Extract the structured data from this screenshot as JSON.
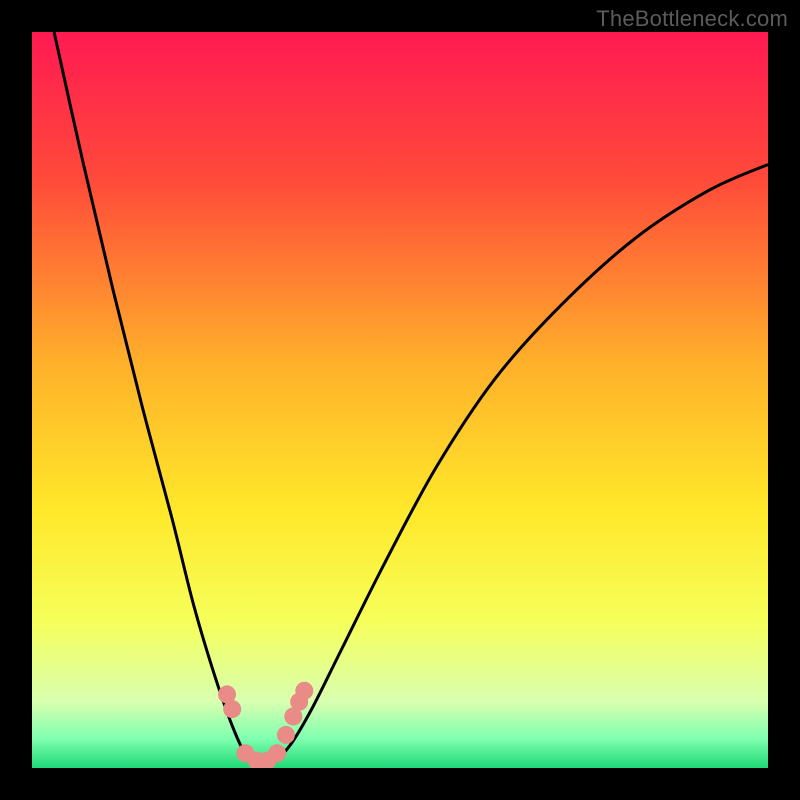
{
  "watermark": "TheBottleneck.com",
  "chart_data": {
    "type": "line",
    "title": "",
    "xlabel": "",
    "ylabel": "",
    "xlim": [
      0,
      100
    ],
    "ylim": [
      0,
      100
    ],
    "background_gradient": {
      "stops": [
        {
          "offset": 0.0,
          "color": "#ff1a52"
        },
        {
          "offset": 0.2,
          "color": "#ff4a3a"
        },
        {
          "offset": 0.45,
          "color": "#ffb02a"
        },
        {
          "offset": 0.65,
          "color": "#ffe82a"
        },
        {
          "offset": 0.8,
          "color": "#f6ff5a"
        },
        {
          "offset": 0.91,
          "color": "#d9ffb0"
        },
        {
          "offset": 0.96,
          "color": "#7fffb0"
        },
        {
          "offset": 1.0,
          "color": "#1fd977"
        }
      ]
    },
    "series": [
      {
        "name": "curve",
        "color": "#000000",
        "x": [
          3.0,
          7.0,
          11.0,
          15.0,
          19.0,
          22.0,
          25.0,
          27.5,
          29.5,
          31.0,
          32.5,
          35.0,
          38.0,
          42.0,
          48.0,
          55.0,
          63.0,
          72.0,
          82.0,
          92.0,
          100.0
        ],
        "values": [
          100.0,
          82.0,
          65.0,
          49.0,
          34.0,
          22.0,
          12.0,
          5.0,
          1.0,
          0.0,
          0.5,
          3.0,
          8.0,
          16.0,
          28.0,
          41.0,
          53.0,
          63.0,
          72.0,
          78.5,
          82.0
        ]
      }
    ],
    "markers": {
      "name": "highlight-points",
      "color": "#e98b87",
      "x": [
        26.5,
        27.2,
        29.0,
        30.5,
        32.0,
        33.3,
        34.5,
        35.5,
        36.3,
        37.0
      ],
      "values": [
        10.0,
        8.0,
        2.0,
        1.0,
        1.0,
        2.0,
        4.5,
        7.0,
        9.0,
        10.5
      ]
    }
  }
}
